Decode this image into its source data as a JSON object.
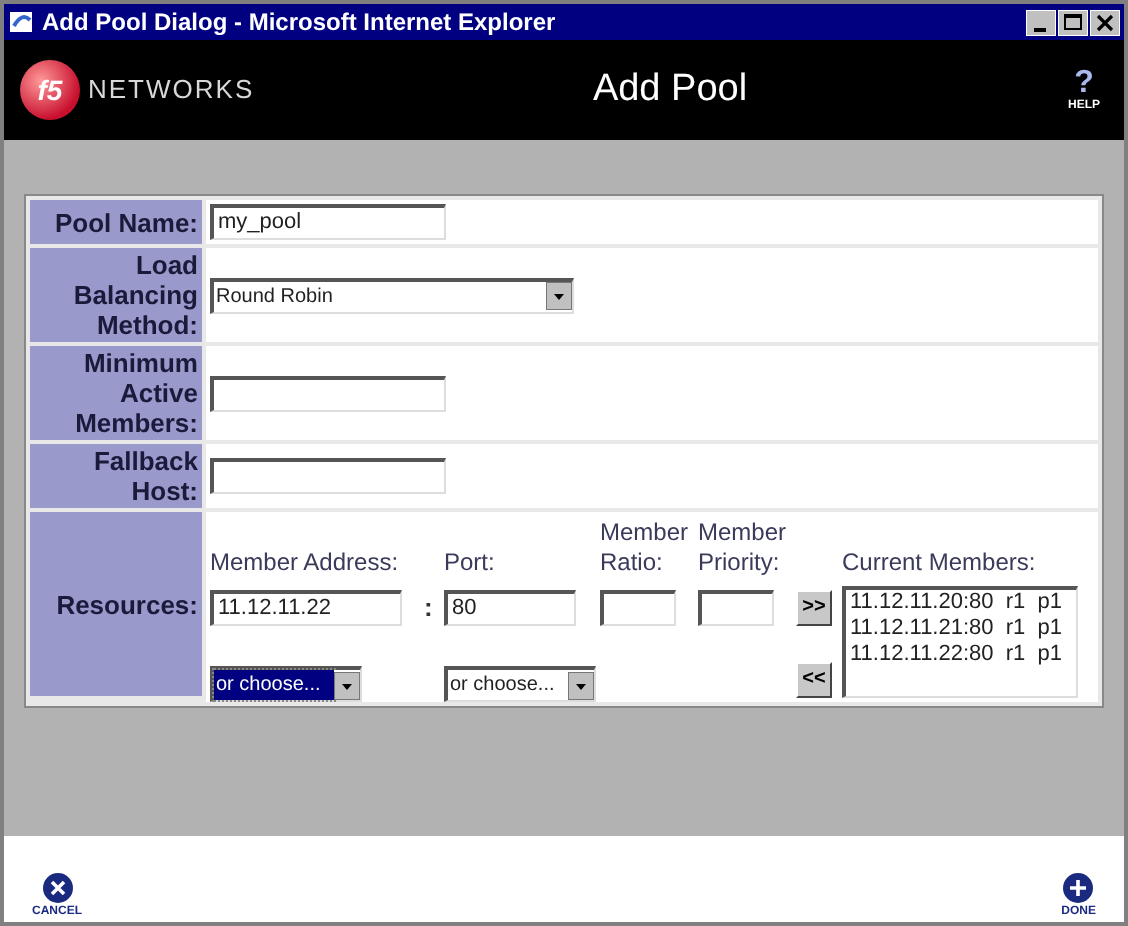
{
  "window": {
    "title": "Add Pool Dialog - Microsoft Internet Explorer"
  },
  "header": {
    "logo_mark": "f5",
    "logo_text": "NETWORKS",
    "title": "Add Pool",
    "help_glyph": "?",
    "help_label": "HELP"
  },
  "form": {
    "rows": [
      {
        "kind": "text",
        "label": "Pool Name:",
        "value": "my_pool"
      },
      {
        "kind": "select",
        "label": "Load\nBalancing\nMethod:",
        "value": "Round Robin"
      },
      {
        "kind": "text",
        "label": "Minimum\nActive\nMembers:"
      },
      {
        "kind": "text",
        "label": "Fallback\nHost:"
      }
    ]
  },
  "resources": {
    "label": "Resources:",
    "address": {
      "heading": "Member Address:",
      "value": "11.12.11.22",
      "choose": {
        "value": "or choose...",
        "highlighted": true
      }
    },
    "separator": ":",
    "port": {
      "heading": "Port:",
      "value": "80",
      "choose": {
        "value": "or choose...",
        "highlighted": false
      }
    },
    "ratio": {
      "heading": "Member\nRatio:"
    },
    "priority": {
      "heading": "Member\nPriority:"
    },
    "add_button": ">>",
    "remove_button": "<<",
    "current_members": {
      "heading": "Current Members:",
      "items": [
        "11.12.11.20:80  r1  p1",
        "11.12.11.21:80  r1  p1",
        "11.12.11.22:80  r1  p1"
      ]
    }
  },
  "footer": {
    "cancel_label": "CANCEL",
    "done_label": "DONE"
  }
}
